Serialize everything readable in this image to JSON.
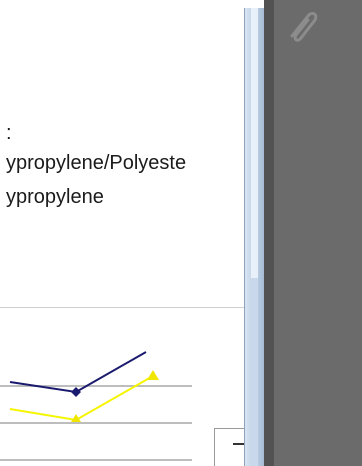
{
  "document": {
    "lines": [
      ":",
      "ypropylene/Polyeste",
      "ypropylene"
    ]
  },
  "attachments": {
    "icon": "paperclip-icon"
  },
  "chart_data": {
    "type": "line",
    "series": [
      {
        "color": "#1a1a6e",
        "values": [
          null,
          null,
          null
        ]
      },
      {
        "color": "#f5f500",
        "values": [
          null,
          null,
          null
        ]
      }
    ]
  }
}
